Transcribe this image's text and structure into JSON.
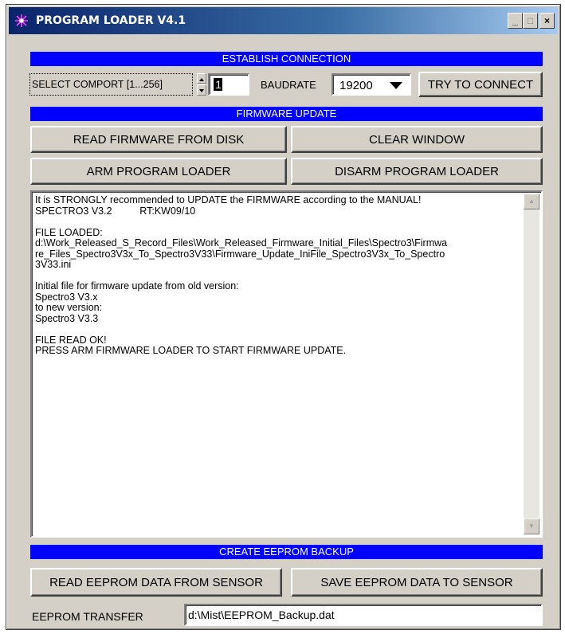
{
  "window": {
    "title": "PROGRAM LOADER V4.1"
  },
  "titlebar": {
    "minimize": "_",
    "maximize": "□",
    "close": "×"
  },
  "connection": {
    "header": "ESTABLISH CONNECTION",
    "comport_label": "SELECT COMPORT [1...256]",
    "comport_value": "1",
    "baudrate_label": "BAUDRATE",
    "baudrate_value": "19200",
    "connect_button": "TRY TO CONNECT"
  },
  "firmware": {
    "header": "FIRMWARE UPDATE",
    "read_button": "READ FIRMWARE FROM DISK",
    "clear_button": "CLEAR WINDOW",
    "arm_button": "ARM PROGRAM LOADER",
    "disarm_button": "DISARM PROGRAM LOADER",
    "log_text": "It is STRONGLY recommended to UPDATE the FIRMWARE according to the MANUAL!\nSPECTRO3 V3.2          RT:KW09/10\n\nFILE LOADED:\nd:\\Work_Released_S_Record_Files\\Work_Released_Firmware_Initial_Files\\Spectro3\\Firmwa\nre_Files_Spectro3V3x_To_Spectro3V33\\Firmware_Update_IniFile_Spectro3V3x_To_Spectro\n3V33.ini\n\nInitial file for firmware update from old version:\nSpectro3 V3.x\nto new version:\nSpectro3 V3.3\n\nFILE READ OK!\nPRESS ARM FIRMWARE LOADER TO START FIRMWARE UPDATE."
  },
  "eeprom": {
    "header": "CREATE EEPROM BACKUP",
    "read_button": "READ EEPROM DATA FROM SENSOR",
    "save_button": "SAVE EEPROM DATA TO SENSOR",
    "transfer_label": "EEPROM TRANSFER",
    "transfer_value": "d:\\Mist\\EEPROM_Backup.dat"
  }
}
